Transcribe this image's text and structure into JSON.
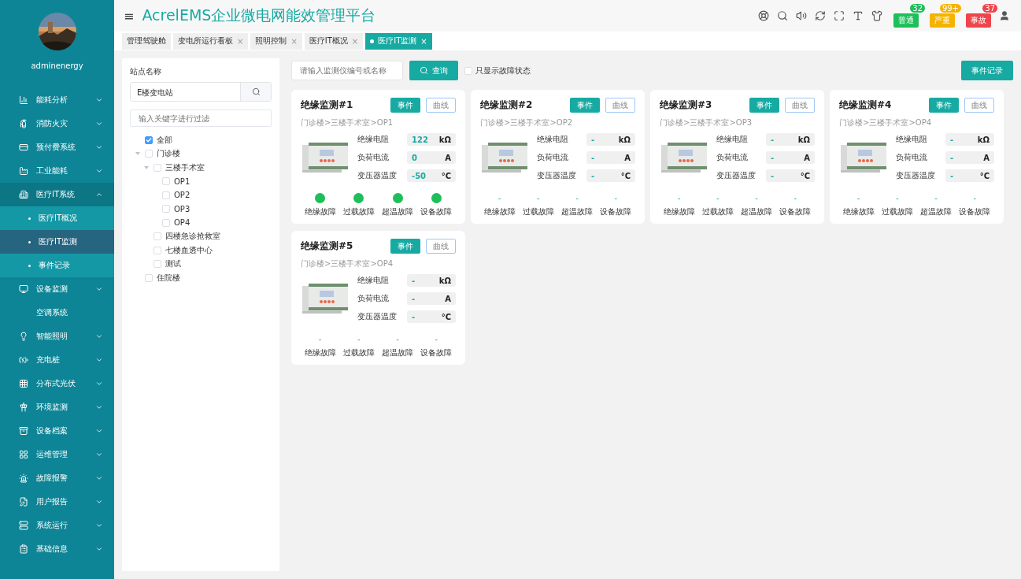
{
  "header": {
    "menu_glyph": "≡",
    "title": "AcrelEMS企业微电网能效管理平台",
    "alarms": [
      {
        "label": "普通",
        "count": "32",
        "color": "#1dbf5a"
      },
      {
        "label": "严重",
        "count": "99+",
        "color": "#f5b300"
      },
      {
        "label": "事故",
        "count": "37",
        "color": "#f0444a"
      }
    ]
  },
  "sidebar": {
    "user": "adminenergy",
    "items": [
      {
        "kind": "group",
        "label": "能耗分析",
        "expanded": false
      },
      {
        "kind": "group",
        "label": "消防火灾",
        "expanded": false
      },
      {
        "kind": "group",
        "label": "预付费系统",
        "expanded": false
      },
      {
        "kind": "group",
        "label": "工业能耗",
        "expanded": false
      },
      {
        "kind": "group",
        "label": "医疗IT系统",
        "expanded": true,
        "children": [
          {
            "label": "医疗IT概况",
            "selected": false
          },
          {
            "label": "医疗IT监测",
            "selected": true
          },
          {
            "label": "事件记录",
            "selected": false
          }
        ]
      },
      {
        "kind": "group",
        "label": "设备监测",
        "expanded": false
      },
      {
        "kind": "plain",
        "label": "空调系统"
      },
      {
        "kind": "group",
        "label": "智能照明",
        "expanded": false
      },
      {
        "kind": "group",
        "label": "充电桩",
        "expanded": false
      },
      {
        "kind": "group",
        "label": "分布式光伏",
        "expanded": false
      },
      {
        "kind": "group",
        "label": "环境监测",
        "expanded": false
      },
      {
        "kind": "group",
        "label": "设备档案",
        "expanded": false
      },
      {
        "kind": "group",
        "label": "运维管理",
        "expanded": false
      },
      {
        "kind": "group",
        "label": "故障报警",
        "expanded": false
      },
      {
        "kind": "group",
        "label": "用户报告",
        "expanded": false
      },
      {
        "kind": "group",
        "label": "系统运行",
        "expanded": false
      },
      {
        "kind": "group",
        "label": "基础信息",
        "expanded": false
      }
    ]
  },
  "tabs": [
    {
      "label": "管理驾驶舱",
      "selected": false
    },
    {
      "label": "变电所运行看板",
      "close": "×",
      "selected": false
    },
    {
      "label": "照明控制",
      "close": "×",
      "selected": false
    },
    {
      "label": "医疗IT概况",
      "close": "×",
      "selected": false
    },
    {
      "label": "医疗IT监测",
      "close": "×",
      "selected": true
    }
  ],
  "site_panel": {
    "label": "站点名称",
    "site": "E楼变电站",
    "filter_placeholder": "输入关键字进行过滤",
    "tree": [
      {
        "label": "全部",
        "checked": true
      },
      {
        "label": "门诊楼",
        "checked": false,
        "expanded": true,
        "children": [
          {
            "label": "三楼手术室",
            "checked": false,
            "expanded": true,
            "children": [
              {
                "label": "OP1",
                "checked": false
              },
              {
                "label": "OP2",
                "checked": false
              },
              {
                "label": "OP3",
                "checked": false
              },
              {
                "label": "OP4",
                "checked": false
              }
            ]
          },
          {
            "label": "四楼急诊抢救室",
            "checked": false
          },
          {
            "label": "七楼血透中心",
            "checked": false
          },
          {
            "label": "测试",
            "checked": false
          }
        ]
      },
      {
        "label": "住院楼",
        "checked": false
      }
    ]
  },
  "toolbar": {
    "search_placeholder": "请输入监测仪编号或名称",
    "query_button": "查询",
    "fault_only": {
      "label": "只显示故障状态",
      "checked": false
    },
    "event_log_button": "事件记录"
  },
  "monitors": [
    {
      "title": "绝缘监测#1",
      "event_button": "事件",
      "curve_button": "曲线",
      "path": "门诊楼>三楼手术室>OP1",
      "readings": [
        {
          "label": "绝缘电阻",
          "value": "122",
          "unit": "kΩ"
        },
        {
          "label": "负荷电流",
          "value": "0",
          "unit": "A"
        },
        {
          "label": "变压器温度",
          "value": "-50",
          "unit": "°C"
        }
      ],
      "faults": [
        {
          "label": "绝缘故障",
          "kind": "dot"
        },
        {
          "label": "过载故障",
          "kind": "dot"
        },
        {
          "label": "超温故障",
          "kind": "dot"
        },
        {
          "label": "设备故障",
          "kind": "dot"
        }
      ]
    },
    {
      "title": "绝缘监测#2",
      "event_button": "事件",
      "curve_button": "曲线",
      "path": "门诊楼>三楼手术室>OP2",
      "readings": [
        {
          "label": "绝缘电阻",
          "value": "-",
          "unit": "kΩ"
        },
        {
          "label": "负荷电流",
          "value": "-",
          "unit": "A"
        },
        {
          "label": "变压器温度",
          "value": "-",
          "unit": "°C"
        }
      ],
      "faults": [
        {
          "label": "绝缘故障",
          "kind": "dash",
          "value": "-"
        },
        {
          "label": "过载故障",
          "kind": "dash",
          "value": "-"
        },
        {
          "label": "超温故障",
          "kind": "dash",
          "value": "-"
        },
        {
          "label": "设备故障",
          "kind": "dash",
          "value": "-"
        }
      ]
    },
    {
      "title": "绝缘监测#3",
      "event_button": "事件",
      "curve_button": "曲线",
      "path": "门诊楼>三楼手术室>OP3",
      "readings": [
        {
          "label": "绝缘电阻",
          "value": "-",
          "unit": "kΩ"
        },
        {
          "label": "负荷电流",
          "value": "-",
          "unit": "A"
        },
        {
          "label": "变压器温度",
          "value": "-",
          "unit": "°C"
        }
      ],
      "faults": [
        {
          "label": "绝缘故障",
          "kind": "dash",
          "value": "-"
        },
        {
          "label": "过载故障",
          "kind": "dash",
          "value": "-"
        },
        {
          "label": "超温故障",
          "kind": "dash",
          "value": "-"
        },
        {
          "label": "设备故障",
          "kind": "dash",
          "value": "-"
        }
      ]
    },
    {
      "title": "绝缘监测#4",
      "event_button": "事件",
      "curve_button": "曲线",
      "path": "门诊楼>三楼手术室>OP4",
      "readings": [
        {
          "label": "绝缘电阻",
          "value": "-",
          "unit": "kΩ"
        },
        {
          "label": "负荷电流",
          "value": "-",
          "unit": "A"
        },
        {
          "label": "变压器温度",
          "value": "-",
          "unit": "°C"
        }
      ],
      "faults": [
        {
          "label": "绝缘故障",
          "kind": "dash",
          "value": "-"
        },
        {
          "label": "过载故障",
          "kind": "dash",
          "value": "-"
        },
        {
          "label": "超温故障",
          "kind": "dash",
          "value": "-"
        },
        {
          "label": "设备故障",
          "kind": "dash",
          "value": "-"
        }
      ]
    },
    {
      "title": "绝缘监测#5",
      "event_button": "事件",
      "curve_button": "曲线",
      "path": "门诊楼>三楼手术室>OP4",
      "readings": [
        {
          "label": "绝缘电阻",
          "value": "-",
          "unit": "kΩ"
        },
        {
          "label": "负荷电流",
          "value": "-",
          "unit": "A"
        },
        {
          "label": "变压器温度",
          "value": "-",
          "unit": "°C"
        }
      ],
      "faults": [
        {
          "label": "绝缘故障",
          "kind": "dash",
          "value": "-"
        },
        {
          "label": "过载故障",
          "kind": "dash",
          "value": "-"
        },
        {
          "label": "超温故障",
          "kind": "dash",
          "value": "-"
        },
        {
          "label": "设备故障",
          "kind": "dash",
          "value": "-"
        }
      ]
    }
  ]
}
